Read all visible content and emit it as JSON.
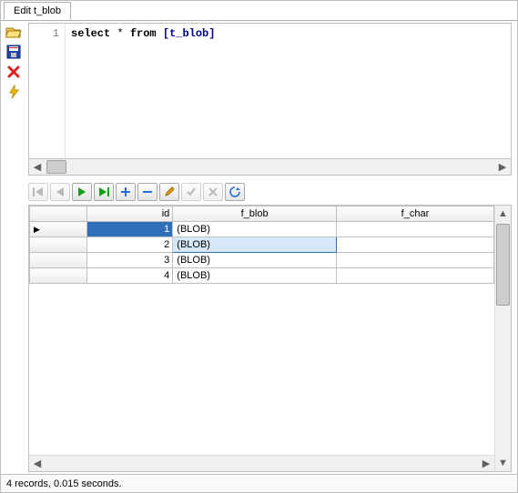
{
  "tab": {
    "title": "Edit t_blob"
  },
  "editor": {
    "line_number": "1",
    "sql_kw_select": "select",
    "sql_star": " * ",
    "sql_kw_from": "from",
    "sql_space": " ",
    "sql_ident": "[t_blob]"
  },
  "side_icons": {
    "open": "open-icon",
    "save": "save-icon",
    "delete": "delete-icon",
    "run": "run-icon"
  },
  "nav_icons": {
    "first": "first-icon",
    "prev": "prev-icon",
    "next": "next-icon",
    "last": "last-icon",
    "add": "plus-icon",
    "remove": "minus-icon",
    "edit": "pencil-icon",
    "commit": "check-icon",
    "cancel": "x-icon",
    "refresh": "refresh-icon"
  },
  "grid": {
    "columns": {
      "rowhead": "",
      "id": "id",
      "f_blob": "f_blob",
      "f_char": "f_char"
    },
    "rows": [
      {
        "marker": "▶",
        "id": "1",
        "f_blob": "(BLOB)",
        "f_char": ""
      },
      {
        "marker": "",
        "id": "2",
        "f_blob": "(BLOB)",
        "f_char": ""
      },
      {
        "marker": "",
        "id": "3",
        "f_blob": "(BLOB)",
        "f_char": ""
      },
      {
        "marker": "",
        "id": "4",
        "f_blob": "(BLOB)",
        "f_char": ""
      }
    ],
    "selected_row_index": 1
  },
  "status": {
    "text": "4 records, 0.015 seconds."
  },
  "glyphs": {
    "left": "◀",
    "right": "▶",
    "up": "▲",
    "down": "▼"
  }
}
